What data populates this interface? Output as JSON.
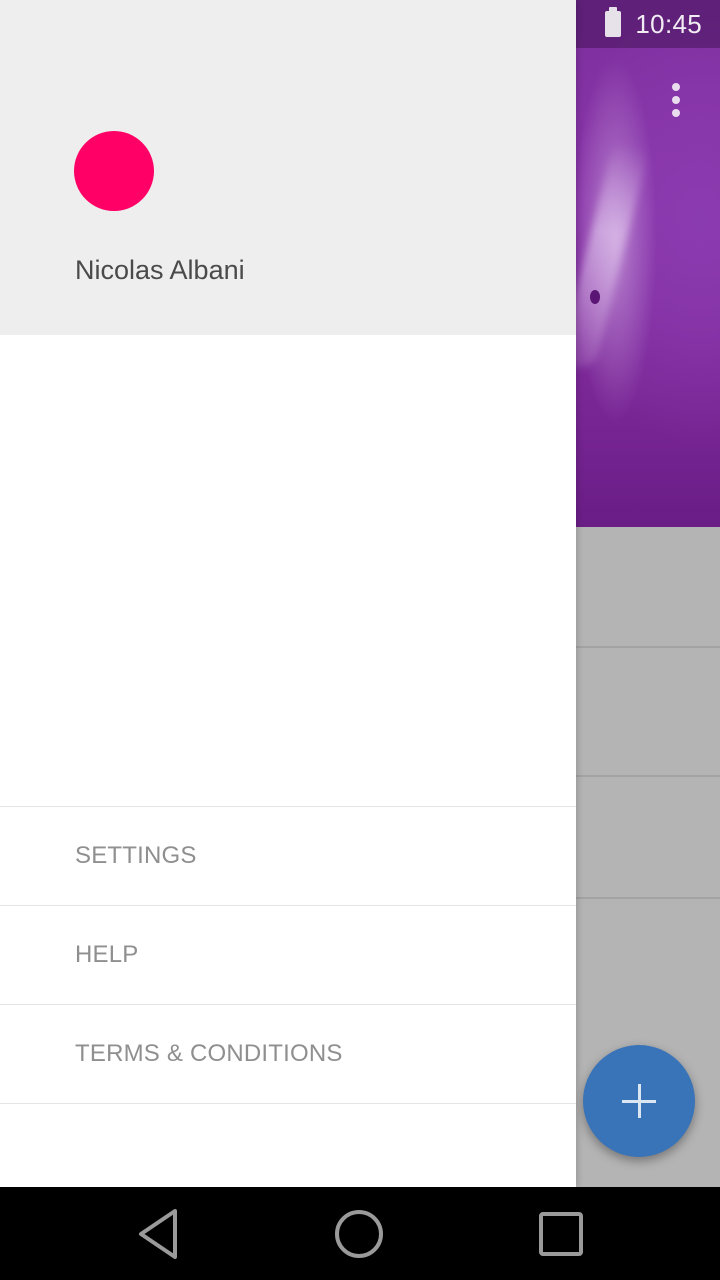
{
  "status_bar": {
    "time": "10:45",
    "battery_icon": "battery-icon"
  },
  "background_app": {
    "overflow_icon": "more-vert-icon",
    "fab_icon": "plus-icon",
    "colors": {
      "hero": "#7d2f9e",
      "list": "#b4b4b4",
      "fab": "#3a74b8"
    }
  },
  "drawer": {
    "header": {
      "user_name": "Nicolas Albani",
      "avatar_color": "#ff0066"
    },
    "menu": [
      {
        "label": "SETTINGS"
      },
      {
        "label": "HELP"
      },
      {
        "label": "TERMS & CONDITIONS"
      }
    ]
  },
  "nav_bar": {
    "back_icon": "back-triangle-icon",
    "home_icon": "home-circle-icon",
    "recents_icon": "recents-square-icon"
  }
}
